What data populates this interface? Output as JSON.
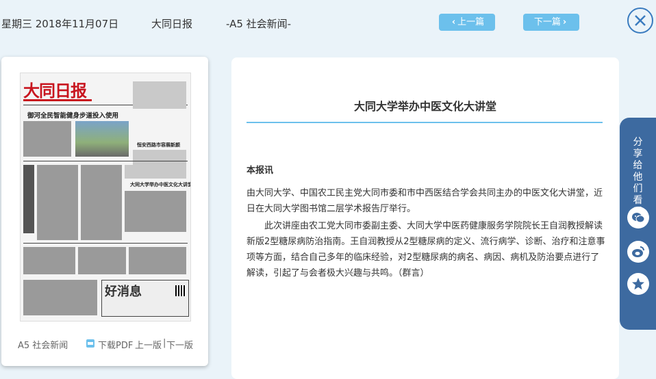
{
  "header": {
    "date": "星期三 2018年11月07日",
    "paper_name": "大同日报",
    "section": "-A5 社会新闻-",
    "prev_label": "上一篇",
    "next_label": "下一篇"
  },
  "thumbnail": {
    "masthead": "大同日报",
    "headlines": {
      "h1": "御河全民智能健身步道投入使用",
      "h2": "大同大学举办中医文化大讲堂",
      "h3": "恒安西路市容展新颜",
      "ad": "好消息"
    },
    "section_label": "A5 社会新闻",
    "pdf_label": "下载PDF",
    "prev_page": "上一版",
    "separator": "|",
    "next_page": "下一版"
  },
  "article": {
    "title": "大同大学举办中医文化大讲堂",
    "byline": "本报讯",
    "paragraphs": [
      "由大同大学、中国农工民主党大同市委和市中西医结合学会共同主办的中医文化大讲堂，近日在大同大学图书馆二层学术报告厅举行。",
      "此次讲座由农工党大同市委副主委、大同大学中医药健康服务学院院长王自润教授解读新版2型糖尿病防治指南。王自润教授从2型糖尿病的定义、流行病学、诊断、治疗和注意事项等方面，结合自己多年的临床经验，对2型糖尿病的病名、病因、病机及防治要点进行了解读，引起了与会者极大兴趣与共鸣。（群言）"
    ]
  },
  "share": {
    "label": "分享给他们看看"
  },
  "colors": {
    "accent": "#6cc0ec",
    "share_bg": "#3d6aa0",
    "close_border": "#3a7bbf"
  },
  "icons": [
    "chevron-left-icon",
    "chevron-right-icon",
    "close-icon",
    "pdf-icon",
    "wechat-icon",
    "weibo-icon",
    "star-icon"
  ]
}
